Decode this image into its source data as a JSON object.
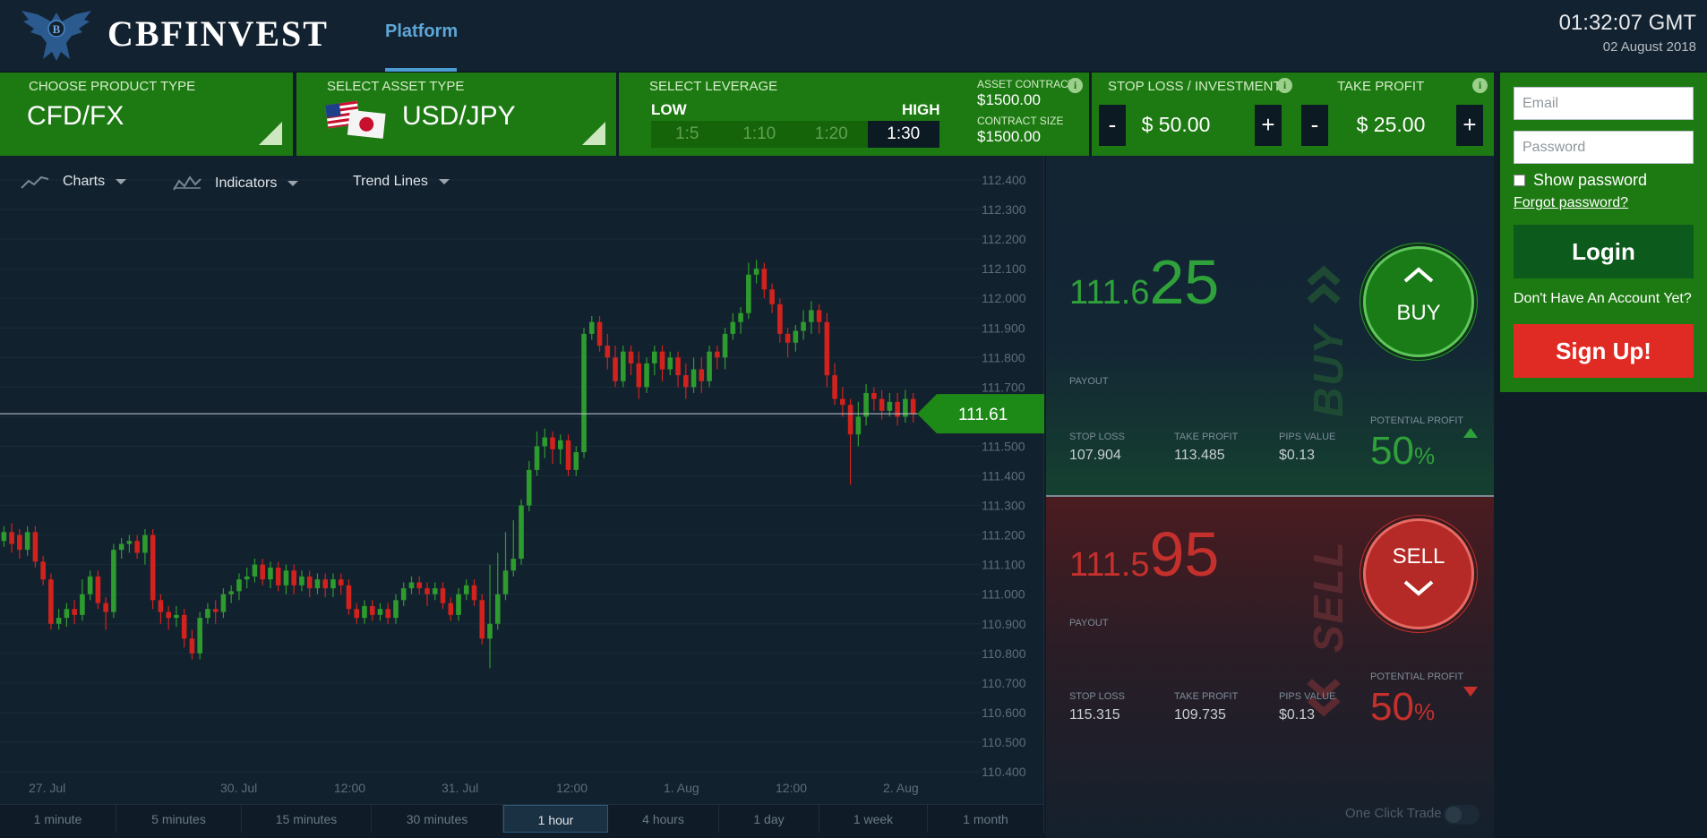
{
  "header": {
    "brand": "CBFINVEST",
    "nav_platform": "Platform",
    "time": "01:32:07 GMT",
    "date": "02 August 2018"
  },
  "product": {
    "label": "CHOOSE PRODUCT TYPE",
    "value": "CFD/FX"
  },
  "asset": {
    "label": "SELECT ASSET TYPE",
    "value": "USD/JPY",
    "flags": [
      "us-flag-icon",
      "japan-flag-icon"
    ]
  },
  "leverage": {
    "label": "SELECT LEVERAGE",
    "low": "LOW",
    "high": "HIGH",
    "options": [
      "1:5",
      "1:10",
      "1:20",
      "1:30"
    ],
    "selected": "1:30",
    "asset_contract_label": "ASSET CONTRACT",
    "asset_contract_value": "$1500.00",
    "contract_size_label": "CONTRACT SIZE",
    "contract_size_value": "$1500.00"
  },
  "stop_loss": {
    "label": "STOP LOSS / INVESTMENT",
    "value": "$ 50.00",
    "minus": "-",
    "plus": "+"
  },
  "take_profit": {
    "label": "TAKE PROFIT",
    "value": "$ 25.00",
    "minus": "-",
    "plus": "+"
  },
  "login": {
    "email_placeholder": "Email",
    "password_placeholder": "Password",
    "show_password": "Show password",
    "forgot": "Forgot password?",
    "login_button": "Login",
    "no_account": "Don't Have An Account Yet?",
    "signup_button": "Sign Up!"
  },
  "toolbar": {
    "charts": "Charts",
    "indicators": "Indicators",
    "trend_lines": "Trend Lines"
  },
  "chart_data": {
    "type": "candlestick",
    "current_price": "111.61",
    "y_ticks": [
      "112.400",
      "112.300",
      "112.200",
      "112.100",
      "112.000",
      "111.900",
      "111.800",
      "111.700",
      "111.600",
      "111.500",
      "111.400",
      "111.300",
      "111.200",
      "111.100",
      "111.000",
      "110.900",
      "110.800",
      "110.700",
      "110.600",
      "110.500",
      "110.400"
    ],
    "ylim": [
      110.4,
      112.4
    ],
    "x_ticks": [
      "27. Jul",
      "30. Jul",
      "12:00",
      "31. Jul",
      "12:00",
      "1. Aug",
      "12:00",
      "2. Aug"
    ],
    "candles": [
      [
        111.18,
        111.21,
        111.23,
        111.16
      ],
      [
        111.21,
        111.17,
        111.24,
        111.14
      ],
      [
        111.2,
        111.15,
        111.22,
        111.12
      ],
      [
        111.15,
        111.21,
        111.23,
        111.13
      ],
      [
        111.21,
        111.11,
        111.23,
        111.09
      ],
      [
        111.11,
        111.05,
        111.13,
        111.03
      ],
      [
        111.05,
        110.9,
        111.07,
        110.88
      ],
      [
        110.9,
        110.92,
        110.95,
        110.88
      ],
      [
        110.92,
        110.95,
        110.97,
        110.89
      ],
      [
        110.95,
        110.93,
        110.98,
        110.9
      ],
      [
        110.93,
        111.0,
        111.05,
        110.91
      ],
      [
        111.0,
        111.06,
        111.08,
        110.98
      ],
      [
        111.06,
        110.97,
        111.08,
        110.95
      ],
      [
        110.97,
        110.94,
        110.99,
        110.88
      ],
      [
        110.94,
        111.15,
        111.17,
        110.92
      ],
      [
        111.15,
        111.17,
        111.19,
        111.12
      ],
      [
        111.17,
        111.18,
        111.2,
        111.14
      ],
      [
        111.18,
        111.14,
        111.2,
        111.12
      ],
      [
        111.14,
        111.2,
        111.22,
        111.1
      ],
      [
        111.2,
        110.98,
        111.22,
        110.95
      ],
      [
        110.98,
        110.94,
        111.0,
        110.9
      ],
      [
        110.94,
        110.92,
        110.96,
        110.88
      ],
      [
        110.92,
        110.93,
        110.96,
        110.89
      ],
      [
        110.93,
        110.85,
        110.95,
        110.82
      ],
      [
        110.85,
        110.8,
        110.88,
        110.78
      ],
      [
        110.8,
        110.92,
        110.94,
        110.78
      ],
      [
        110.92,
        110.95,
        110.97,
        110.9
      ],
      [
        110.95,
        110.94,
        110.98,
        110.9
      ],
      [
        110.94,
        111.0,
        111.02,
        110.92
      ],
      [
        111.0,
        111.01,
        111.03,
        110.97
      ],
      [
        111.01,
        111.05,
        111.07,
        110.98
      ],
      [
        111.05,
        111.06,
        111.09,
        111.02
      ],
      [
        111.06,
        111.1,
        111.12,
        111.04
      ],
      [
        111.1,
        111.05,
        111.12,
        111.03
      ],
      [
        111.05,
        111.09,
        111.11,
        111.02
      ],
      [
        111.09,
        111.03,
        111.11,
        111.01
      ],
      [
        111.03,
        111.08,
        111.1,
        111.0
      ],
      [
        111.08,
        111.03,
        111.1,
        111.0
      ],
      [
        111.03,
        111.06,
        111.08,
        111.01
      ],
      [
        111.06,
        111.02,
        111.08,
        110.99
      ],
      [
        111.02,
        111.05,
        111.07,
        111.0
      ],
      [
        111.05,
        111.02,
        111.07,
        110.99
      ],
      [
        111.02,
        111.05,
        111.07,
        110.99
      ],
      [
        111.05,
        111.03,
        111.07,
        111.0
      ],
      [
        111.03,
        110.95,
        111.05,
        110.93
      ],
      [
        110.95,
        110.92,
        110.97,
        110.9
      ],
      [
        110.92,
        110.96,
        110.98,
        110.9
      ],
      [
        110.96,
        110.93,
        110.98,
        110.91
      ],
      [
        110.93,
        110.95,
        110.97,
        110.91
      ],
      [
        110.95,
        110.92,
        110.97,
        110.9
      ],
      [
        110.92,
        110.98,
        111.0,
        110.9
      ],
      [
        110.98,
        111.02,
        111.04,
        110.96
      ],
      [
        111.02,
        111.04,
        111.06,
        111.0
      ],
      [
        111.04,
        111.02,
        111.06,
        111.0
      ],
      [
        111.02,
        111.0,
        111.04,
        110.96
      ],
      [
        111.0,
        111.02,
        111.04,
        110.98
      ],
      [
        111.02,
        110.97,
        111.04,
        110.95
      ],
      [
        110.97,
        110.93,
        110.99,
        110.91
      ],
      [
        110.93,
        111.0,
        111.02,
        110.91
      ],
      [
        111.0,
        111.03,
        111.05,
        110.98
      ],
      [
        111.03,
        110.98,
        111.05,
        110.96
      ],
      [
        110.98,
        110.85,
        111.0,
        110.83
      ],
      [
        110.85,
        110.9,
        111.1,
        110.75
      ],
      [
        110.9,
        111.0,
        111.14,
        110.88
      ],
      [
        111.0,
        111.08,
        111.21,
        110.98
      ],
      [
        111.08,
        111.12,
        111.25,
        111.06
      ],
      [
        111.12,
        111.3,
        111.32,
        111.1
      ],
      [
        111.3,
        111.42,
        111.45,
        111.28
      ],
      [
        111.42,
        111.5,
        111.55,
        111.4
      ],
      [
        111.5,
        111.53,
        111.56,
        111.46
      ],
      [
        111.53,
        111.49,
        111.55,
        111.44
      ],
      [
        111.49,
        111.52,
        111.54,
        111.44
      ],
      [
        111.52,
        111.42,
        111.54,
        111.4
      ],
      [
        111.42,
        111.48,
        111.5,
        111.4
      ],
      [
        111.48,
        111.88,
        111.9,
        111.46
      ],
      [
        111.88,
        111.92,
        111.94,
        111.86
      ],
      [
        111.92,
        111.84,
        111.94,
        111.82
      ],
      [
        111.84,
        111.8,
        111.88,
        111.76
      ],
      [
        111.8,
        111.72,
        111.84,
        111.7
      ],
      [
        111.72,
        111.82,
        111.84,
        111.7
      ],
      [
        111.82,
        111.78,
        111.84,
        111.74
      ],
      [
        111.78,
        111.7,
        111.82,
        111.66
      ],
      [
        111.7,
        111.78,
        111.8,
        111.68
      ],
      [
        111.78,
        111.82,
        111.84,
        111.74
      ],
      [
        111.82,
        111.76,
        111.84,
        111.72
      ],
      [
        111.76,
        111.8,
        111.82,
        111.74
      ],
      [
        111.8,
        111.74,
        111.82,
        111.7
      ],
      [
        111.74,
        111.7,
        111.78,
        111.66
      ],
      [
        111.7,
        111.76,
        111.8,
        111.68
      ],
      [
        111.76,
        111.72,
        111.8,
        111.68
      ],
      [
        111.72,
        111.82,
        111.84,
        111.7
      ],
      [
        111.82,
        111.8,
        111.84,
        111.76
      ],
      [
        111.8,
        111.88,
        111.9,
        111.76
      ],
      [
        111.88,
        111.92,
        111.95,
        111.86
      ],
      [
        111.92,
        111.95,
        111.97,
        111.88
      ],
      [
        111.95,
        112.08,
        112.12,
        111.93
      ],
      [
        112.08,
        112.1,
        112.13,
        112.05
      ],
      [
        112.1,
        112.03,
        112.12,
        112.0
      ],
      [
        112.03,
        111.98,
        112.05,
        111.95
      ],
      [
        111.98,
        111.88,
        112.0,
        111.85
      ],
      [
        111.88,
        111.85,
        111.9,
        111.8
      ],
      [
        111.85,
        111.89,
        111.91,
        111.82
      ],
      [
        111.89,
        111.92,
        111.96,
        111.86
      ],
      [
        111.92,
        111.96,
        111.99,
        111.88
      ],
      [
        111.96,
        111.92,
        111.98,
        111.88
      ],
      [
        111.92,
        111.74,
        111.95,
        111.7
      ],
      [
        111.74,
        111.66,
        111.78,
        111.64
      ],
      [
        111.66,
        111.64,
        111.7,
        111.6
      ],
      [
        111.64,
        111.54,
        111.66,
        111.37
      ],
      [
        111.54,
        111.6,
        111.65,
        111.5
      ],
      [
        111.6,
        111.68,
        111.71,
        111.57
      ],
      [
        111.68,
        111.66,
        111.7,
        111.62
      ],
      [
        111.66,
        111.62,
        111.69,
        111.59
      ],
      [
        111.62,
        111.65,
        111.68,
        111.6
      ],
      [
        111.65,
        111.6,
        111.68,
        111.57
      ],
      [
        111.6,
        111.66,
        111.69,
        111.58
      ],
      [
        111.66,
        111.61,
        111.68,
        111.58
      ]
    ]
  },
  "timeframes": [
    "1 minute",
    "5 minutes",
    "15 minutes",
    "30 minutes",
    "1 hour",
    "4 hours",
    "1 day",
    "1 week",
    "1 month"
  ],
  "timeframe_selected": "1 hour",
  "buy": {
    "price_small": "111.6",
    "price_big": "25",
    "payout_label": "PAYOUT",
    "stop_loss_label": "STOP LOSS",
    "stop_loss": "107.904",
    "take_profit_label": "TAKE PROFIT",
    "take_profit": "113.485",
    "pips_label": "PIPS VALUE",
    "pips": "$0.13",
    "pp_label": "POTENTIAL PROFIT",
    "pp_value": "50",
    "pp_pct": "%",
    "button": "BUY",
    "watermark": "BUY"
  },
  "sell": {
    "price_small": "111.5",
    "price_big": "95",
    "payout_label": "PAYOUT",
    "stop_loss_label": "STOP LOSS",
    "stop_loss": "115.315",
    "take_profit_label": "TAKE PROFIT",
    "take_profit": "109.735",
    "pips_label": "PIPS VALUE",
    "pips": "$0.13",
    "pp_label": "POTENTIAL PROFIT",
    "pp_value": "50",
    "pp_pct": "%",
    "button": "SELL",
    "watermark": "SELL"
  },
  "one_click": "One Click Trade",
  "colors": {
    "accent_green": "#1d7a12",
    "buy_green": "#2fa13a",
    "sell_red": "#c4302c",
    "signup_red": "#e02b25",
    "nav_blue": "#5fa6d6"
  }
}
